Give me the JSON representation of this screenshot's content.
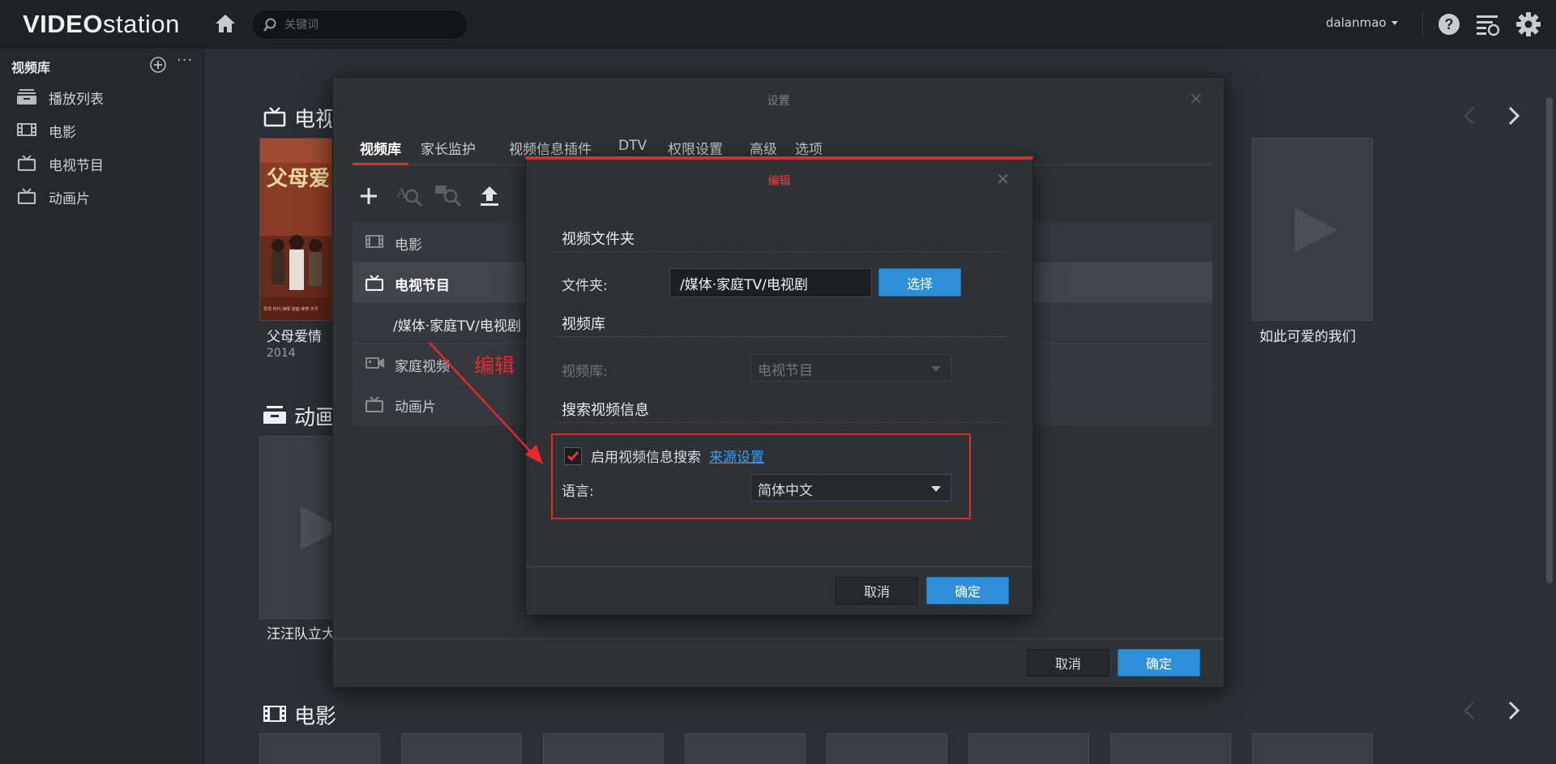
{
  "app": {
    "logo_caps": "VIDEO",
    "logo_rest": "station",
    "search_placeholder": "关键词",
    "user": "dalanmao"
  },
  "sidebar": {
    "title": "视频库",
    "items": [
      {
        "label": "播放列表",
        "icon": "playlist-icon"
      },
      {
        "label": "电影",
        "icon": "film-icon"
      },
      {
        "label": "电视节目",
        "icon": "tv-icon"
      },
      {
        "label": "动画片",
        "icon": "tv-icon"
      }
    ]
  },
  "main": {
    "sections": [
      {
        "title": "电视"
      },
      {
        "title": "动画"
      },
      {
        "title": "电影"
      }
    ],
    "posters": [
      {
        "title": "父母爱情",
        "year": "2014"
      },
      {
        "title": "如此可爱的我们"
      },
      {
        "title": "汪汪队立大"
      }
    ],
    "poster_art": {
      "text": "父母爱",
      "caption": "爱情·时代·演绎 家庭·荣誉·岁月"
    }
  },
  "settings": {
    "title": "设置",
    "tabs": [
      "视频库",
      "家长监护",
      "视频信息插件",
      "DTV",
      "权限设置",
      "高级",
      "选项"
    ],
    "libraries": [
      {
        "label": "电影",
        "icon": "film-icon"
      },
      {
        "label": "电视节目",
        "icon": "tv-icon"
      },
      {
        "label": "/媒体·家庭TV/电视剧",
        "icon": ""
      },
      {
        "label": "家庭视频",
        "icon": "camcorder-icon"
      },
      {
        "label": "动画片",
        "icon": "tv-icon"
      }
    ],
    "cancel": "取消",
    "ok": "确定"
  },
  "edit_dialog": {
    "title": "编辑",
    "section_folder": "视频文件夹",
    "folder_label": "文件夹:",
    "folder_value": "/媒体·家庭TV/电视剧",
    "select_button": "选择",
    "section_library": "视频库",
    "library_label": "视频库:",
    "library_value": "电视节目",
    "section_search": "搜索视频信息",
    "enable_search_label": "启用视频信息搜索",
    "enable_search_checked": true,
    "source_link": "来源设置",
    "language_label": "语言:",
    "language_value": "简体中文",
    "cancel": "取消",
    "ok": "确定"
  },
  "annotation": {
    "label": "编辑",
    "color": "#e8282b"
  },
  "colors": {
    "accent_blue": "#2e8fd8",
    "tab_underline": "#d63031",
    "link": "#3a9df2"
  }
}
